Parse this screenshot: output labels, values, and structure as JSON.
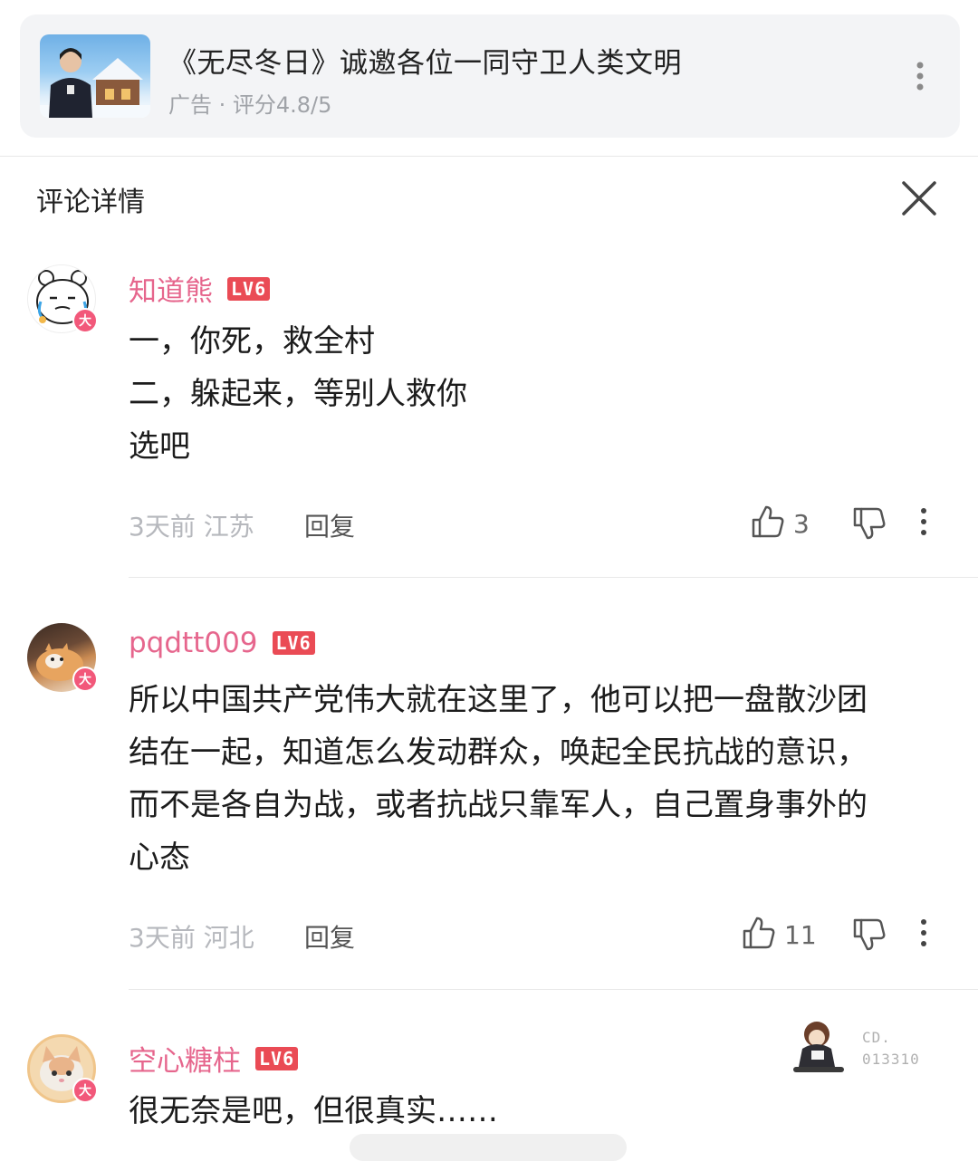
{
  "ad": {
    "title": "《无尽冬日》诚邀各位一同守卫人类文明",
    "subtitle": "广告 · 评分4.8/5"
  },
  "header": {
    "title": "评论详情"
  },
  "comments": [
    {
      "username": "知道熊",
      "level": "LV6",
      "badge": "大",
      "lines": [
        "一，你死，救全村",
        "二，躲起来，等别人救你",
        "选吧"
      ],
      "time_location": "3天前 江苏",
      "reply_label": "回复",
      "likes": "3"
    },
    {
      "username": "pqdtt009",
      "level": "LV6",
      "badge": "大",
      "lines": [
        "所以中国共产党伟大就在这里了，他可以把一盘散沙团",
        "结在一起，知道怎么发动群众，唤起全民抗战的意识，",
        "而不是各自为战，或者抗战只靠军人，自己置身事外的",
        "心态"
      ],
      "time_location": "3天前 河北",
      "reply_label": "回复",
      "likes": "11"
    },
    {
      "username": "空心糖柱",
      "level": "LV6",
      "badge": "大",
      "lines": [
        "很无奈是吧，但很真实……"
      ],
      "sticker_text": [
        "CD.",
        "013310"
      ]
    }
  ],
  "icons": {
    "more": "more-vertical-icon",
    "close": "close-icon",
    "like": "thumbs-up-icon",
    "dislike": "thumbs-down-icon"
  }
}
